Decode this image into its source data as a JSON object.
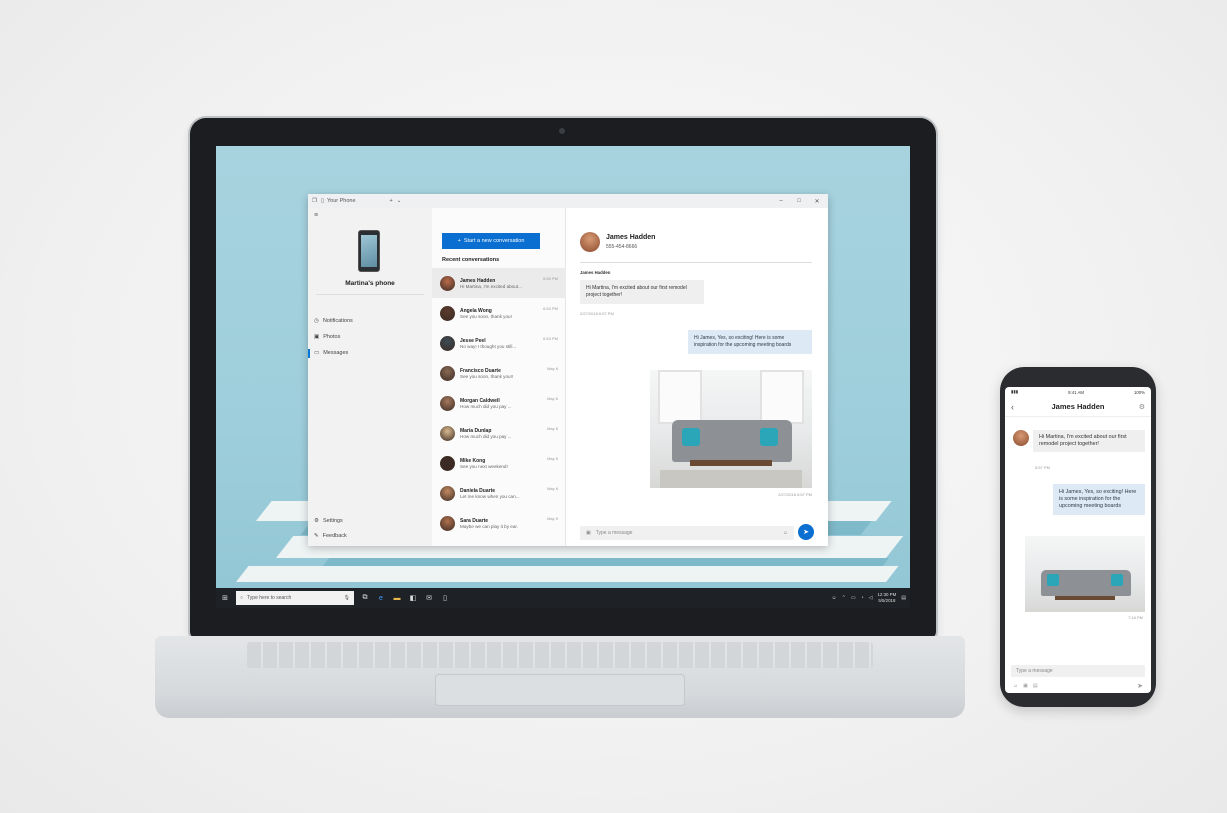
{
  "app": {
    "title": "Your Phone",
    "device_name": "Martina's phone",
    "nav": {
      "notifications": "Notifications",
      "photos": "Photos",
      "messages": "Messages",
      "settings": "Settings",
      "feedback": "Feedback"
    },
    "new_conversation": "Start a new conversation",
    "recent_header": "Recent conversations",
    "conversations": [
      {
        "name": "James Hadden",
        "preview": "Hi Martina, I'm excited about...",
        "time": "6:56 PM",
        "color": "#b96b4a"
      },
      {
        "name": "Angela Wong",
        "preview": "See you soon, thank you!",
        "time": "6:53 PM",
        "color": "#5b3b2e"
      },
      {
        "name": "Jesse Peel",
        "preview": "No way! I thought you still...",
        "time": "6:53 PM",
        "color": "#3d4c57"
      },
      {
        "name": "Francisco Duarte",
        "preview": "See you soon, thank you!!",
        "time": "May 6",
        "color": "#8a6a55"
      },
      {
        "name": "Morgan Caldwell",
        "preview": "How much did you pay ...",
        "time": "May 6",
        "color": "#a5785d"
      },
      {
        "name": "Maria Dunlap",
        "preview": "How much did you pay ...",
        "time": "May 6",
        "color": "#d9b98f"
      },
      {
        "name": "Mike Kong",
        "preview": "See you next weekend!",
        "time": "May 6",
        "color": "#3b2b24"
      },
      {
        "name": "Daniela Duarte",
        "preview": "Let me know when you can...",
        "time": "May 6",
        "color": "#c38a62"
      },
      {
        "name": "Sara Duarte",
        "preview": "Maybe we can play it by ear.",
        "time": "May 5",
        "color": "#b0704d"
      }
    ],
    "chat": {
      "contact_name": "James Hadden",
      "contact_phone": "555-454-8666",
      "sender_label": "James Hadden",
      "incoming": "Hi Martina, I'm excited about our first remodel project together!",
      "incoming_time": "2/27/2018 6:57 PM",
      "outgoing": "Hi James, Yes, so exciting! Here is some inspiration for the upcoming meeting boards",
      "outgoing_time": "2/27/2018 6:57 PM",
      "composer_placeholder": "Type a message"
    }
  },
  "taskbar": {
    "search_placeholder": "Type here to search",
    "clock_time": "12:30 PM",
    "clock_date": "5/5/2018"
  },
  "phone": {
    "status_time": "9:41 AM",
    "status_battery": "100%",
    "contact_name": "James Hadden",
    "incoming": "Hi Martina, I'm excited about our first remodel project together!",
    "incoming_time": "5:57 PM",
    "outgoing": "Hi James, Yes, so exciting! Here is some inspiration for the upcoming meeting boards",
    "outgoing_time": "7:16 PM",
    "composer_placeholder": "Type a message"
  },
  "colors": {
    "accent": "#0a6fd1",
    "outgoing_bubble": "#dde9f5",
    "incoming_bubble": "#efefef",
    "wallpaper": "#a7d3df"
  }
}
